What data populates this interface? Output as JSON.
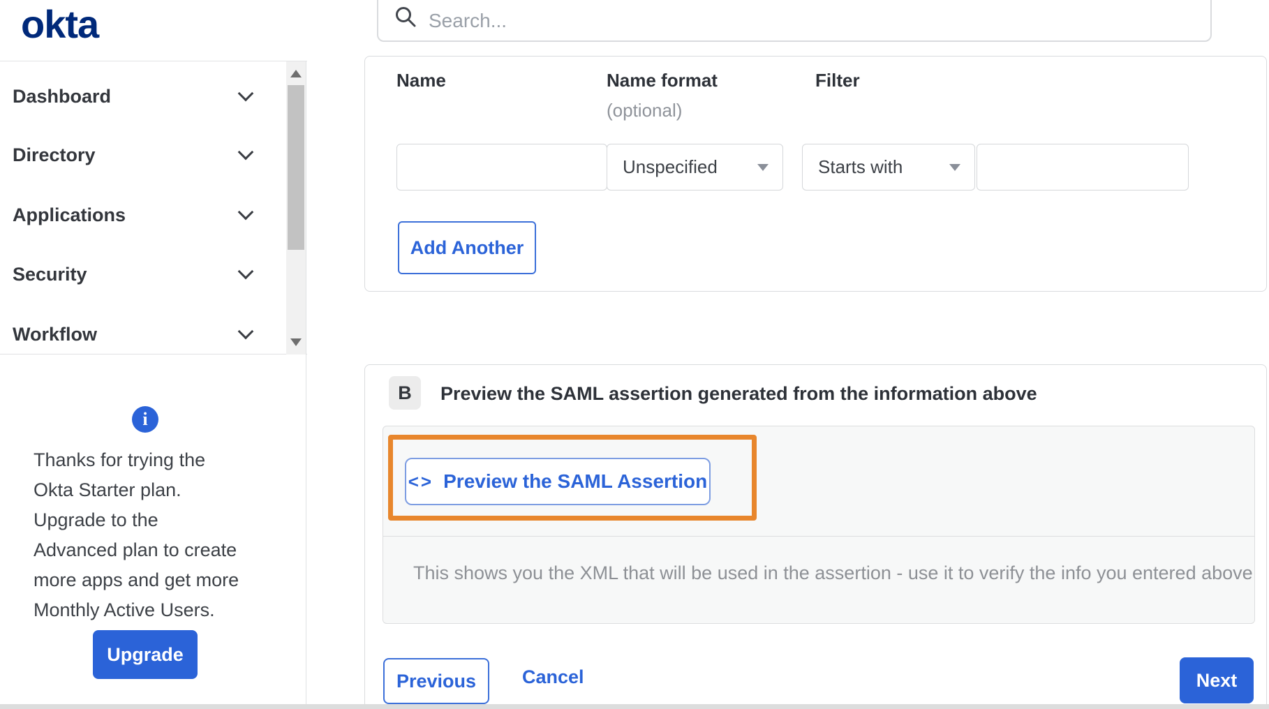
{
  "brand": {
    "logo_text": "okta"
  },
  "header": {
    "search_placeholder": "Search..."
  },
  "sidebar": {
    "nav": [
      {
        "label": "Dashboard"
      },
      {
        "label": "Directory"
      },
      {
        "label": "Applications"
      },
      {
        "label": "Security"
      },
      {
        "label": "Workflow"
      }
    ],
    "promo": {
      "info_icon": "i",
      "text": "Thanks for trying the Okta Starter plan. Upgrade to the Advanced plan to create more apps and get more Monthly Active Users.",
      "upgrade_label": "Upgrade"
    }
  },
  "attribute_form": {
    "columns": {
      "name": "Name",
      "name_format": "Name format",
      "name_format_note": "(optional)",
      "filter": "Filter"
    },
    "row": {
      "name_value": "",
      "name_format_value": "Unspecified",
      "filter_type_value": "Starts with",
      "filter_value": ""
    },
    "add_another_label": "Add Another"
  },
  "preview_section": {
    "badge": "B",
    "title": "Preview the SAML assertion generated from the information above",
    "button_icon": "<>",
    "button_label": "Preview the SAML Assertion",
    "hint": "This shows you the XML that will be used in the assertion - use it to verify the info you entered above"
  },
  "footer": {
    "previous_label": "Previous",
    "cancel_label": "Cancel",
    "next_label": "Next"
  },
  "colors": {
    "accent_blue": "#2b63d8",
    "logo_navy": "#00297a",
    "highlight_orange": "#e8862c"
  }
}
